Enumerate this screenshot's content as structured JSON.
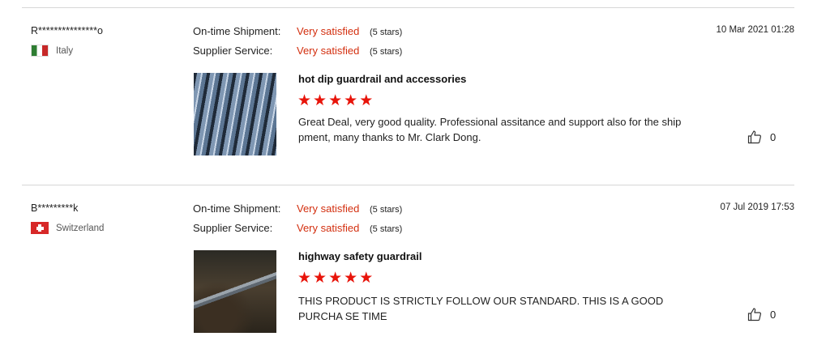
{
  "reviews": [
    {
      "reviewer": "R***************o",
      "country": "Italy",
      "flag_icon": "italy-flag-icon",
      "date": "10 Mar 2021 01:28",
      "ratings": [
        {
          "label": "On-time Shipment:",
          "value": "Very satisfied",
          "stars": "(5 stars)"
        },
        {
          "label": "Supplier Service:",
          "value": "Very satisfied",
          "stars": "(5 stars)"
        }
      ],
      "product": "hot dip guardrail and accessories",
      "product_rating": 5,
      "comment": "Great Deal, very good quality. Professional assitance and support also for the ship pment, many thanks to Mr. Clark Dong.",
      "likes": "0"
    },
    {
      "reviewer": "B*********k",
      "country": "Switzerland",
      "flag_icon": "switzerland-flag-icon",
      "date": "07 Jul 2019 17:53",
      "ratings": [
        {
          "label": "On-time Shipment:",
          "value": "Very satisfied",
          "stars": "(5 stars)"
        },
        {
          "label": "Supplier Service:",
          "value": "Very satisfied",
          "stars": "(5 stars)"
        }
      ],
      "product": "highway safety guardrail",
      "product_rating": 5,
      "comment": "THIS PRODUCT IS STRICTLY FOLLOW OUR STANDARD. THIS IS A GOOD PURCHA SE TIME",
      "likes": "0"
    }
  ],
  "colors": {
    "accent_red": "#d32f0f",
    "star_red": "#e8140a",
    "divider": "#d6d6d6"
  },
  "icons": {
    "star": "star-icon",
    "like": "thumbs-up-icon"
  }
}
